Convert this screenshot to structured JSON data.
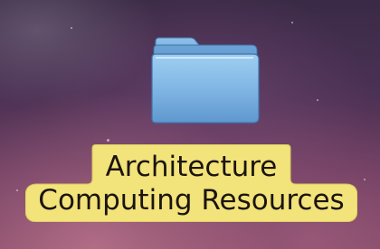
{
  "desktop": {
    "icon": {
      "type": "folder-icon",
      "label_line_1": "Architecture",
      "label_line_2": "Computing Resources",
      "selected": true
    }
  },
  "colors": {
    "label_highlight": "#f2e37a",
    "label_text": "#1b1410",
    "folder_blue": "#7fb3de",
    "wallpaper": "#4a3154"
  }
}
